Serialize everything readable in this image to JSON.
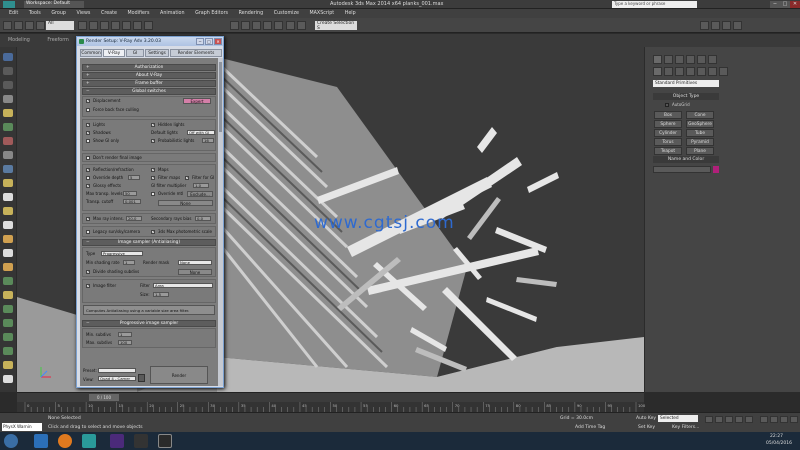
{
  "titlebar": {
    "workspace": "Workspace: Default",
    "title": "Autodesk 3ds Max 2014 x64      planks_001.max",
    "search_placeholder": "Type a keyword or phrase",
    "min": "−",
    "max": "□",
    "close": "✕"
  },
  "menu": [
    "Edit",
    "Tools",
    "Group",
    "Views",
    "Create",
    "Modifiers",
    "Animation",
    "Graph Editors",
    "Rendering",
    "Customize",
    "MAXScript",
    "Help"
  ],
  "toolbar": {
    "filter": "All",
    "selection_set": "Create Selection S"
  },
  "ribbon": [
    "Modeling",
    "Freeform",
    "Selection",
    "Object Paint",
    "Populate"
  ],
  "watermark": "www.cgtsj.com",
  "dialog": {
    "title": "Render Setup: V-Ray Adv 3.20.03",
    "tabs": [
      "Common",
      "V-Ray",
      "GI",
      "Settings",
      "Render Elements"
    ],
    "rollouts": {
      "authorization": "Authorization",
      "about": "About V-Ray",
      "frame_buffer": "Frame buffer",
      "global_switches": "Global switches",
      "image_sampler": "Image sampler (Antialiasing)",
      "progressive": "Progressive image sampler"
    },
    "global": {
      "displacement": "Displacement",
      "expert": "Expert",
      "force_back": "Force back face culling",
      "lights": "Lights",
      "hidden_lights": "Hidden lights",
      "shadows": "Shadows",
      "default_lights": "Default lights",
      "default_lights_val": "Off with GI",
      "show_gi_only": "Show GI only",
      "probabilistic_lights": "Probabilistic lights",
      "probabilistic_val": "16",
      "dont_render_final": "Don't render final image",
      "reflection_refraction": "Reflection/refraction",
      "maps": "Maps",
      "override_depth": "Override depth",
      "override_depth_val": "5",
      "filter_maps": "Filter maps",
      "filter_for_gi": "Filter for GI",
      "glossy_effects": "Glossy effects",
      "gi_filter_multiplier": "GI filter multiplier",
      "gi_filter_val": "1.0",
      "max_transp_levels": "Max transp. levels",
      "max_transp_val": "50",
      "override_mtl": "Override mtl",
      "exclude": "Exclude...",
      "transp_cutoff": "Transp. cutoff",
      "transp_cutoff_val": "0.001",
      "none": "None",
      "max_ray_intens": "Max ray intens.",
      "max_ray_val": "20.0",
      "secondary_rays_bias": "Secondary rays bias",
      "secondary_val": "0.0",
      "legacy_sun": "Legacy sun/sky/camera",
      "photometric_scale": "3ds Max photometric scale"
    },
    "sampler": {
      "type_label": "Type",
      "type_val": "Progressive",
      "min_shading_rate": "Min shading rate",
      "min_shading_val": "1",
      "render_mask": "Render mask",
      "render_mask_val": "None",
      "divide_shading": "Divide shading subdivs",
      "image_filter": "Image filter",
      "filter_label": "Filter",
      "filter_val": "Area",
      "size_label": "Size:",
      "size_val": "1.5",
      "desc": "Computes Antialiasing using a variable size area filter.",
      "min_subdivs": "Min. subdivs",
      "min_subdivs_val": "1",
      "max_subdivs": "Max. subdivs",
      "max_subdivs_val": "100"
    },
    "bottom": {
      "preset_label": "Preset:",
      "view_label": "View:",
      "view_val": "Quad 4 - Camer",
      "render": "Render"
    }
  },
  "rightpanel": {
    "dropdown": "Standard Primitives",
    "object_type": "Object Type",
    "autogrid": "AutoGrid",
    "buttons": [
      "Box",
      "Cone",
      "Sphere",
      "GeoSphere",
      "Cylinder",
      "Tube",
      "Torus",
      "Pyramid",
      "Teapot",
      "Plane"
    ],
    "name_and_color": "Name and Color"
  },
  "timeline": {
    "frame": "0 / 100"
  },
  "ruler": [
    "0",
    "5",
    "10",
    "15",
    "20",
    "25",
    "30",
    "35",
    "40",
    "45",
    "50",
    "55",
    "60",
    "65",
    "70",
    "75",
    "80",
    "85",
    "90",
    "95",
    "100"
  ],
  "status": {
    "selected": "None Selected",
    "hint": "Click and drag to select and move objects",
    "grid": "Grid = 30.0cm",
    "add_time_tag": "Add Time Tag",
    "auto_key": "Auto Key",
    "set_key": "Set Key",
    "selected_btn": "Selected",
    "key_filters": "Key Filters...",
    "maxscript": "PhysX Warnin"
  },
  "taskbar": {
    "time": "22:27",
    "date": "05/04/2016"
  }
}
